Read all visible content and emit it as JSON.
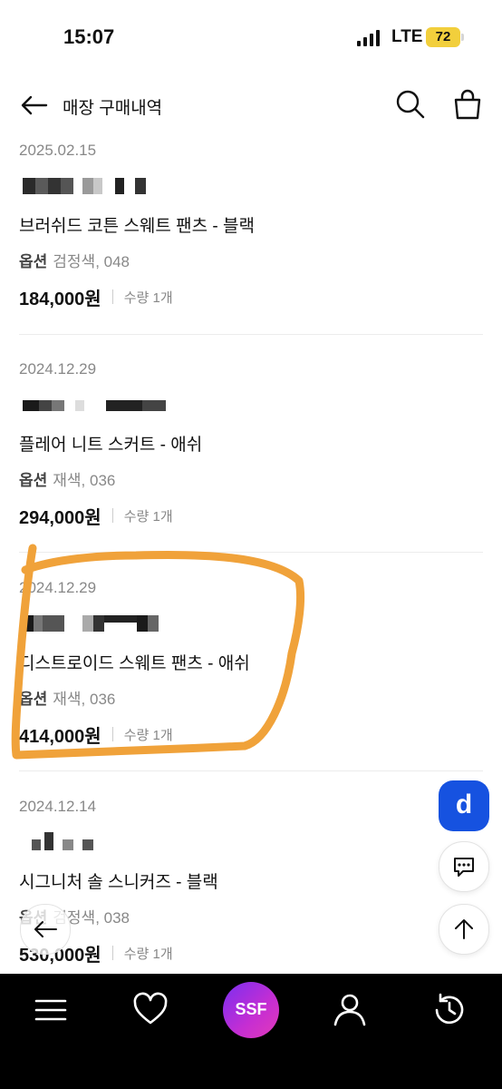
{
  "status_bar": {
    "time": "15:07",
    "network": "LTE",
    "battery": "72"
  },
  "header": {
    "title": "매장 구매내역",
    "back_icon": "arrow-left-icon",
    "search_icon": "search-icon",
    "bag_icon": "shopping-bag-icon"
  },
  "orders": [
    {
      "date": "2025.02.15",
      "product": "브러쉬드 코튼 스웨트 팬츠 - 블랙",
      "option_label": "옵션",
      "option_value": "검정색, 048",
      "price": "184,000원",
      "qty": "수량 1개"
    },
    {
      "date": "2024.12.29",
      "product": "플레어 니트 스커트 - 애쉬",
      "option_label": "옵션",
      "option_value": "재색, 036",
      "price": "294,000원",
      "qty": "수량 1개"
    },
    {
      "date": "2024.12.29",
      "product": "디스트로이드 스웨트 팬츠 - 애쉬",
      "option_label": "옵션",
      "option_value": "재색, 036",
      "price": "414,000원",
      "qty": "수량 1개"
    },
    {
      "date": "2024.12.14",
      "product": "시그니처 솔 스니커즈 - 블랙",
      "option_label": "옵션",
      "option_value": "검정색, 038",
      "price": "530,000원",
      "qty": "수량 1개"
    }
  ],
  "floating": {
    "d_label": "d",
    "chat_icon": "chat-icon",
    "top_icon": "arrow-up-icon",
    "back_icon": "arrow-left-icon"
  },
  "bottom_nav": {
    "menu_icon": "menu-icon",
    "heart_icon": "heart-icon",
    "ssf_label": "SSF",
    "profile_icon": "user-icon",
    "history_icon": "history-icon"
  },
  "colors": {
    "accent_blue": "#1652e0",
    "highlight_orange": "#f0a23a",
    "battery_yellow": "#f2cf3c"
  }
}
